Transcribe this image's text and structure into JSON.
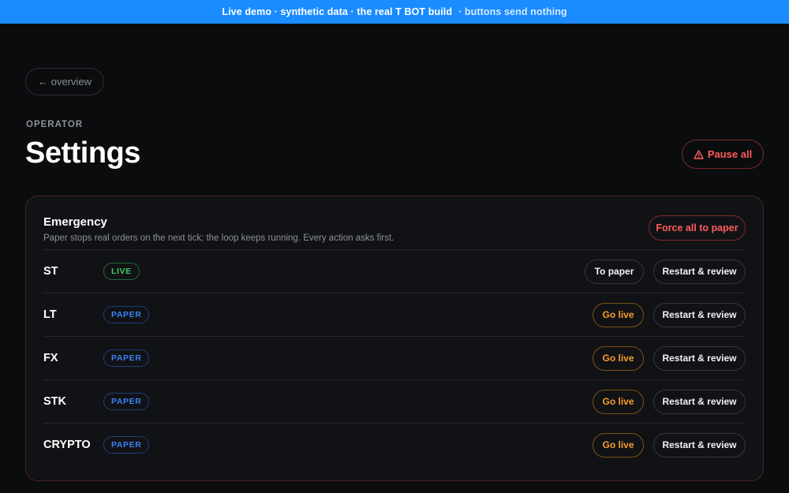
{
  "banner": {
    "text": "Live demo · synthetic data · the real T BOT build",
    "note": "· buttons send nothing"
  },
  "nav": {
    "back_label": "← overview"
  },
  "header": {
    "eyebrow": "OPERATOR",
    "title": "Settings",
    "pause_all_icon": "warning-icon",
    "pause_all_label": "Pause all"
  },
  "emergency": {
    "title": "Emergency",
    "subtitle": "Paper stops real orders on the next tick; the loop keeps running. Every action asks first.",
    "force_label": "Force all to paper",
    "rows": [
      {
        "name": "ST",
        "mode": "LIVE",
        "action": "To paper",
        "restart": "Restart & review"
      },
      {
        "name": "LT",
        "mode": "PAPER",
        "action": "Go live",
        "restart": "Restart & review"
      },
      {
        "name": "FX",
        "mode": "PAPER",
        "action": "Go live",
        "restart": "Restart & review"
      },
      {
        "name": "STK",
        "mode": "PAPER",
        "action": "Go live",
        "restart": "Restart & review"
      },
      {
        "name": "CRYPTO",
        "mode": "PAPER",
        "action": "Go live",
        "restart": "Restart & review"
      }
    ]
  },
  "colors": {
    "banner": "#1a8cff",
    "danger": "#ff5b5b",
    "live": "#3fcf65",
    "paper": "#3b82f6",
    "go_live": "#f59e2b"
  }
}
